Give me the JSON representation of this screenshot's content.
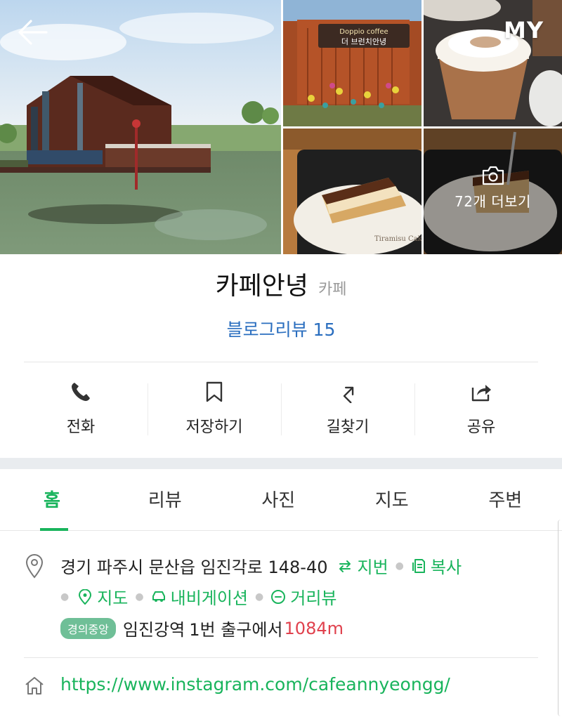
{
  "header": {
    "back_icon": "arrow-left-icon",
    "my_label": "MY"
  },
  "gallery": {
    "more_label": "72개 더보기",
    "sign_text": "Doppio coffee 더 브런치안녕"
  },
  "place": {
    "name": "카페안녕",
    "category": "카페",
    "blog_review": "블로그리뷰 15"
  },
  "actions": [
    {
      "label": "전화",
      "icon": "phone-icon"
    },
    {
      "label": "저장하기",
      "icon": "bookmark-icon"
    },
    {
      "label": "길찾기",
      "icon": "directions-icon"
    },
    {
      "label": "공유",
      "icon": "share-icon"
    }
  ],
  "tabs": [
    {
      "label": "홈",
      "active": true
    },
    {
      "label": "리뷰"
    },
    {
      "label": "사진"
    },
    {
      "label": "지도"
    },
    {
      "label": "주변"
    }
  ],
  "info": {
    "address": "경기 파주시 문산읍 임진각로 148-40",
    "jibun": "지번",
    "copy": "복사",
    "map": "지도",
    "navigation": "내비게이션",
    "street_view": "거리뷰",
    "subway_line": "경의중앙",
    "station": "임진강역",
    "exit": "1번 출구에서",
    "distance": "1084m",
    "homepage": "https://www.instagram.com/cafeannyeongg/"
  },
  "colors": {
    "accent_green": "#19b45c",
    "blog_blue": "#2a6ebf",
    "distance_red": "#e0414d",
    "subway_badge": "#6fbf97"
  }
}
